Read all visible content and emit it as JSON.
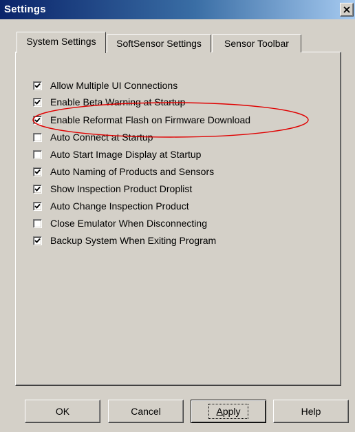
{
  "window": {
    "title": "Settings",
    "close_glyph": "×"
  },
  "tabs": [
    {
      "label": "System Settings",
      "active": true
    },
    {
      "label": "SoftSensor Settings",
      "active": false
    },
    {
      "label": "Sensor Toolbar",
      "active": false
    }
  ],
  "options": [
    {
      "label": "Allow Multiple UI Connections",
      "checked": true
    },
    {
      "label": "Enable Beta Warning at Startup",
      "checked": true
    },
    {
      "label": "Enable Reformat Flash on Firmware Download",
      "checked": true
    },
    {
      "label": "Auto Connect at Startup",
      "checked": false
    },
    {
      "label": "Auto Start Image Display at Startup",
      "checked": false
    },
    {
      "label": "Auto Naming of Products and Sensors",
      "checked": true
    },
    {
      "label": "Show Inspection Product Droplist",
      "checked": true
    },
    {
      "label": "Auto Change Inspection Product",
      "checked": true
    },
    {
      "label": "Close Emulator When Disconnecting",
      "checked": false
    },
    {
      "label": "Backup System When Exiting Program",
      "checked": true
    }
  ],
  "buttons": {
    "ok": "OK",
    "cancel": "Cancel",
    "apply_mnemonic": "A",
    "apply_rest": "pply",
    "help": "Help"
  },
  "colors": {
    "titlebar": "#0a246a",
    "dialog_face": "#d4d0c8",
    "annotation_ellipse": "#e00000"
  }
}
